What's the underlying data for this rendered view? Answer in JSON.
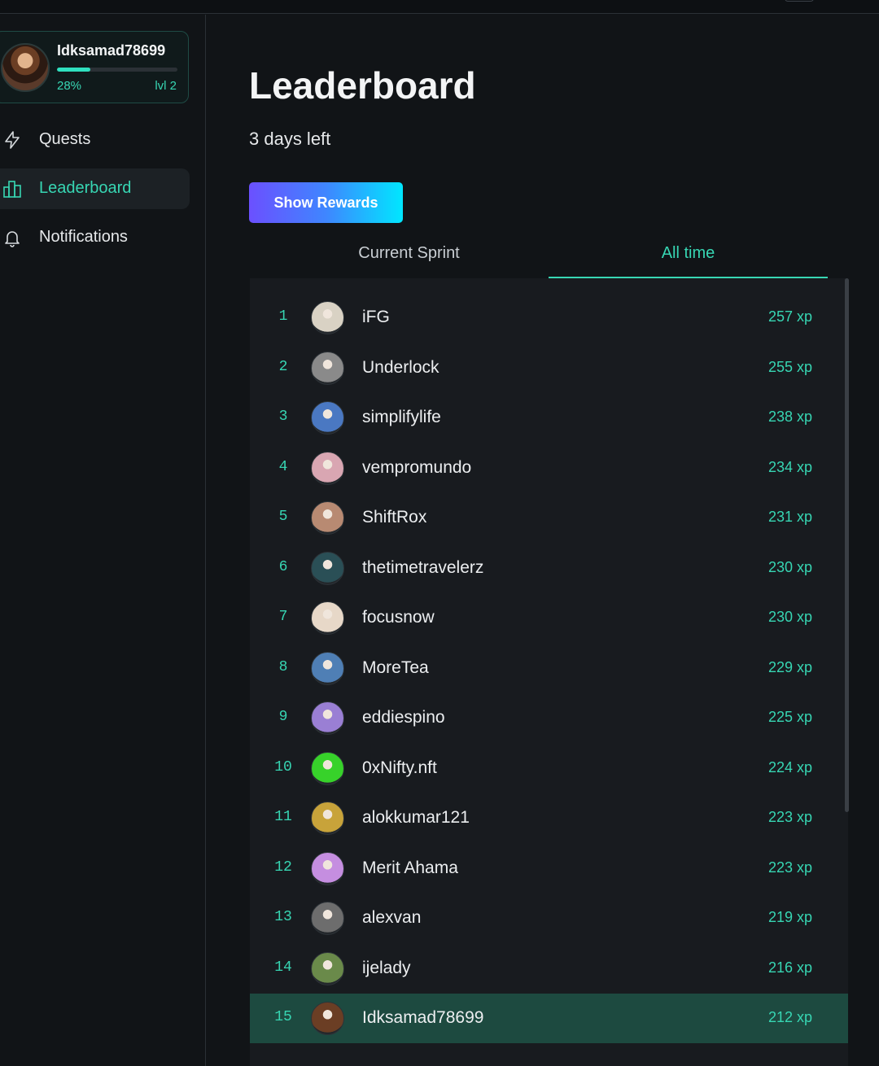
{
  "user": {
    "name": "Idksamad78699",
    "progress_label": "28%",
    "progress": 0.28,
    "level": "lvl 2"
  },
  "nav": [
    {
      "label": "Quests",
      "icon": "lightning-icon",
      "active": false
    },
    {
      "label": "Leaderboard",
      "icon": "bar-chart-icon",
      "active": true
    },
    {
      "label": "Notifications",
      "icon": "bell-icon",
      "active": false
    }
  ],
  "main": {
    "title": "Leaderboard",
    "subtitle": "3 days left",
    "rewards_button": "Show Rewards",
    "tabs": [
      {
        "label": "Current Sprint",
        "active": false
      },
      {
        "label": "All time",
        "active": true
      }
    ]
  },
  "leaderboard": [
    {
      "rank": "1",
      "name": "iFG",
      "xp": "257 xp",
      "avatar": "#d9d2c4"
    },
    {
      "rank": "2",
      "name": "Underlock",
      "xp": "255 xp",
      "avatar": "#8a8a8a"
    },
    {
      "rank": "3",
      "name": "simplifylife",
      "xp": "238 xp",
      "avatar": "#4a78c2"
    },
    {
      "rank": "4",
      "name": "vempromundo",
      "xp": "234 xp",
      "avatar": "#d9a6b2"
    },
    {
      "rank": "5",
      "name": "ShiftRox",
      "xp": "231 xp",
      "avatar": "#b88a72"
    },
    {
      "rank": "6",
      "name": "thetimetravelerz",
      "xp": "230 xp",
      "avatar": "#2a4f56"
    },
    {
      "rank": "7",
      "name": "focusnow",
      "xp": "230 xp",
      "avatar": "#e7d8c8"
    },
    {
      "rank": "8",
      "name": "MoreTea",
      "xp": "229 xp",
      "avatar": "#4f7fb5"
    },
    {
      "rank": "9",
      "name": "eddiespino",
      "xp": "225 xp",
      "avatar": "#9a7fd4"
    },
    {
      "rank": "10",
      "name": "0xNifty.nft",
      "xp": "224 xp",
      "avatar": "#37d22a"
    },
    {
      "rank": "11",
      "name": "alokkumar121",
      "xp": "223 xp",
      "avatar": "#c8a33a"
    },
    {
      "rank": "12",
      "name": "Merit Ahama",
      "xp": "223 xp",
      "avatar": "#c58ee0"
    },
    {
      "rank": "13",
      "name": "alexvan",
      "xp": "219 xp",
      "avatar": "#6d6d6d"
    },
    {
      "rank": "14",
      "name": "ijelady",
      "xp": "216 xp",
      "avatar": "#6a8a4a"
    },
    {
      "rank": "15",
      "name": "Idksamad78699",
      "xp": "212 xp",
      "avatar": "#6b3e24",
      "me": true
    }
  ],
  "colors": {
    "accent": "#37d6b3",
    "background": "#111417",
    "board": "#181b1f",
    "highlight_row": "#1d4a40"
  }
}
